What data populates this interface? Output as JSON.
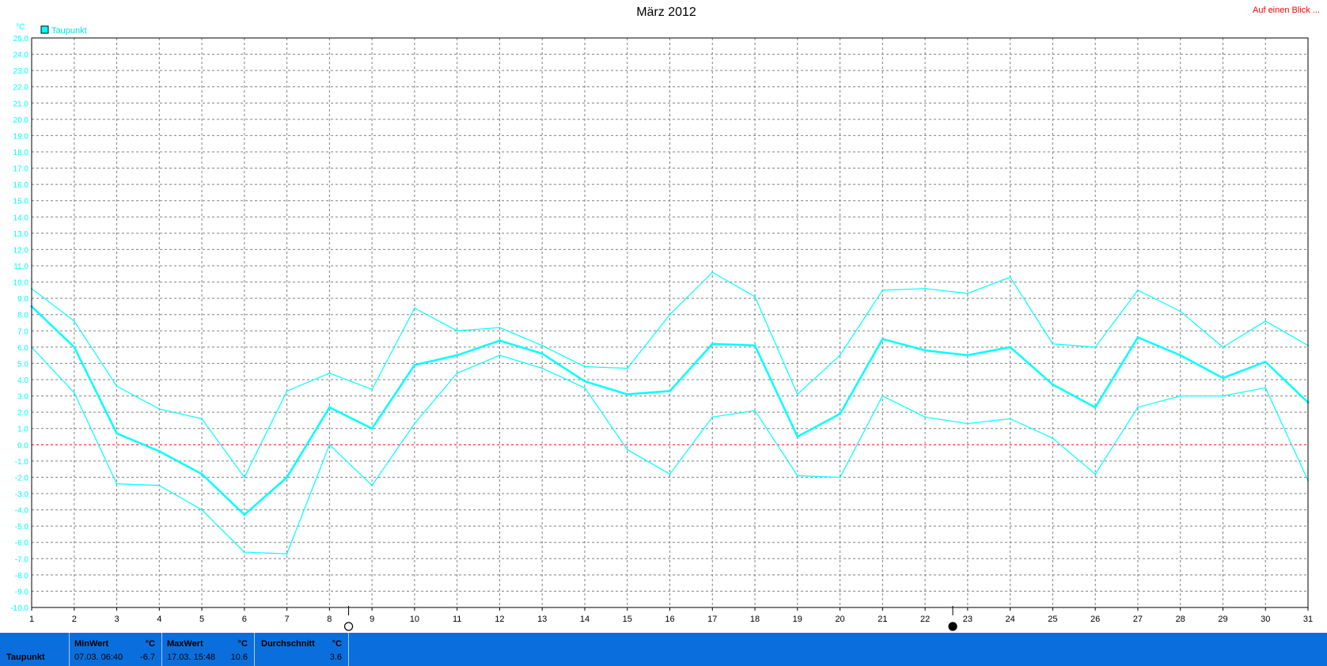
{
  "title": "März 2012",
  "top_link": "Auf einen Blick ...",
  "colors": {
    "series": "#00ffff",
    "zero_line": "#ff0000",
    "grid": "#808080",
    "stats_bar": "#0a6fdc"
  },
  "chart_data": {
    "type": "line",
    "title": "März 2012",
    "ylabel": "°C",
    "xlabel": "",
    "ylim": [
      -10,
      25
    ],
    "yticks": [
      "25.0",
      "24.0",
      "23.0",
      "22.0",
      "21.0",
      "20.0",
      "19.0",
      "18.0",
      "17.0",
      "16.0",
      "15.0",
      "14.0",
      "13.0",
      "12.0",
      "11.0",
      "10.0",
      "9.0",
      "8.0",
      "7.0",
      "6.0",
      "5.0",
      "4.0",
      "3.0",
      "2.0",
      "1.0",
      "0.0",
      "-1.0",
      "-2.0",
      "-3.0",
      "-4.0",
      "-5.0",
      "-6.0",
      "-7.0",
      "-8.0",
      "-9.0",
      "-10.0"
    ],
    "x": [
      1,
      2,
      3,
      4,
      5,
      6,
      7,
      8,
      9,
      10,
      11,
      12,
      13,
      14,
      15,
      16,
      17,
      18,
      19,
      20,
      21,
      22,
      23,
      24,
      25,
      26,
      27,
      28,
      29,
      30,
      31
    ],
    "grid": true,
    "legend": {
      "position": "top-left",
      "entries": [
        "Taupunkt"
      ]
    },
    "series": [
      {
        "name": "Taupunkt",
        "role": "max",
        "values": [
          9.6,
          7.6,
          3.6,
          2.2,
          1.6,
          -2.0,
          3.3,
          4.4,
          3.4,
          8.4,
          7.0,
          7.2,
          6.1,
          4.8,
          4.7,
          8.0,
          10.6,
          9.1,
          3.1,
          5.5,
          9.5,
          9.6,
          9.3,
          10.3,
          6.2,
          6.0,
          9.5,
          8.2,
          6.0,
          7.6,
          6.1
        ]
      },
      {
        "name": "Taupunkt",
        "role": "avg",
        "values": [
          8.5,
          6.0,
          0.7,
          -0.4,
          -1.8,
          -4.3,
          -2.0,
          2.3,
          1.0,
          4.9,
          5.5,
          6.4,
          5.6,
          3.9,
          3.1,
          3.3,
          6.2,
          6.1,
          0.5,
          1.9,
          6.5,
          5.8,
          5.5,
          6.0,
          3.7,
          2.3,
          6.6,
          5.5,
          4.1,
          5.1,
          2.6
        ]
      },
      {
        "name": "Taupunkt",
        "role": "min",
        "values": [
          6.0,
          3.2,
          -2.4,
          -2.5,
          -4.0,
          -6.6,
          -6.7,
          0.0,
          -2.5,
          1.3,
          4.4,
          5.5,
          4.7,
          3.5,
          -0.3,
          -1.8,
          1.7,
          2.1,
          -1.9,
          -2.0,
          3.0,
          1.7,
          1.3,
          1.6,
          0.4,
          -1.8,
          2.3,
          3.0,
          3.0,
          3.5,
          -2.2
        ]
      }
    ],
    "markers": [
      {
        "label": "first-quarter",
        "x": 8.45,
        "symbol": "○"
      },
      {
        "label": "full-moon",
        "x": 22.65,
        "symbol": "●"
      }
    ]
  },
  "stats": {
    "row_label": "Taupunkt",
    "min": {
      "label": "MinWert",
      "unit": "°C",
      "timestamp": "07.03.  06:40",
      "value": "-6.7"
    },
    "max": {
      "label": "MaxWert",
      "unit": "°C",
      "timestamp": "17.03.  15:48",
      "value": "10.6"
    },
    "avg": {
      "label": "Durchschnitt",
      "unit": "°C",
      "value": "3.6"
    }
  }
}
